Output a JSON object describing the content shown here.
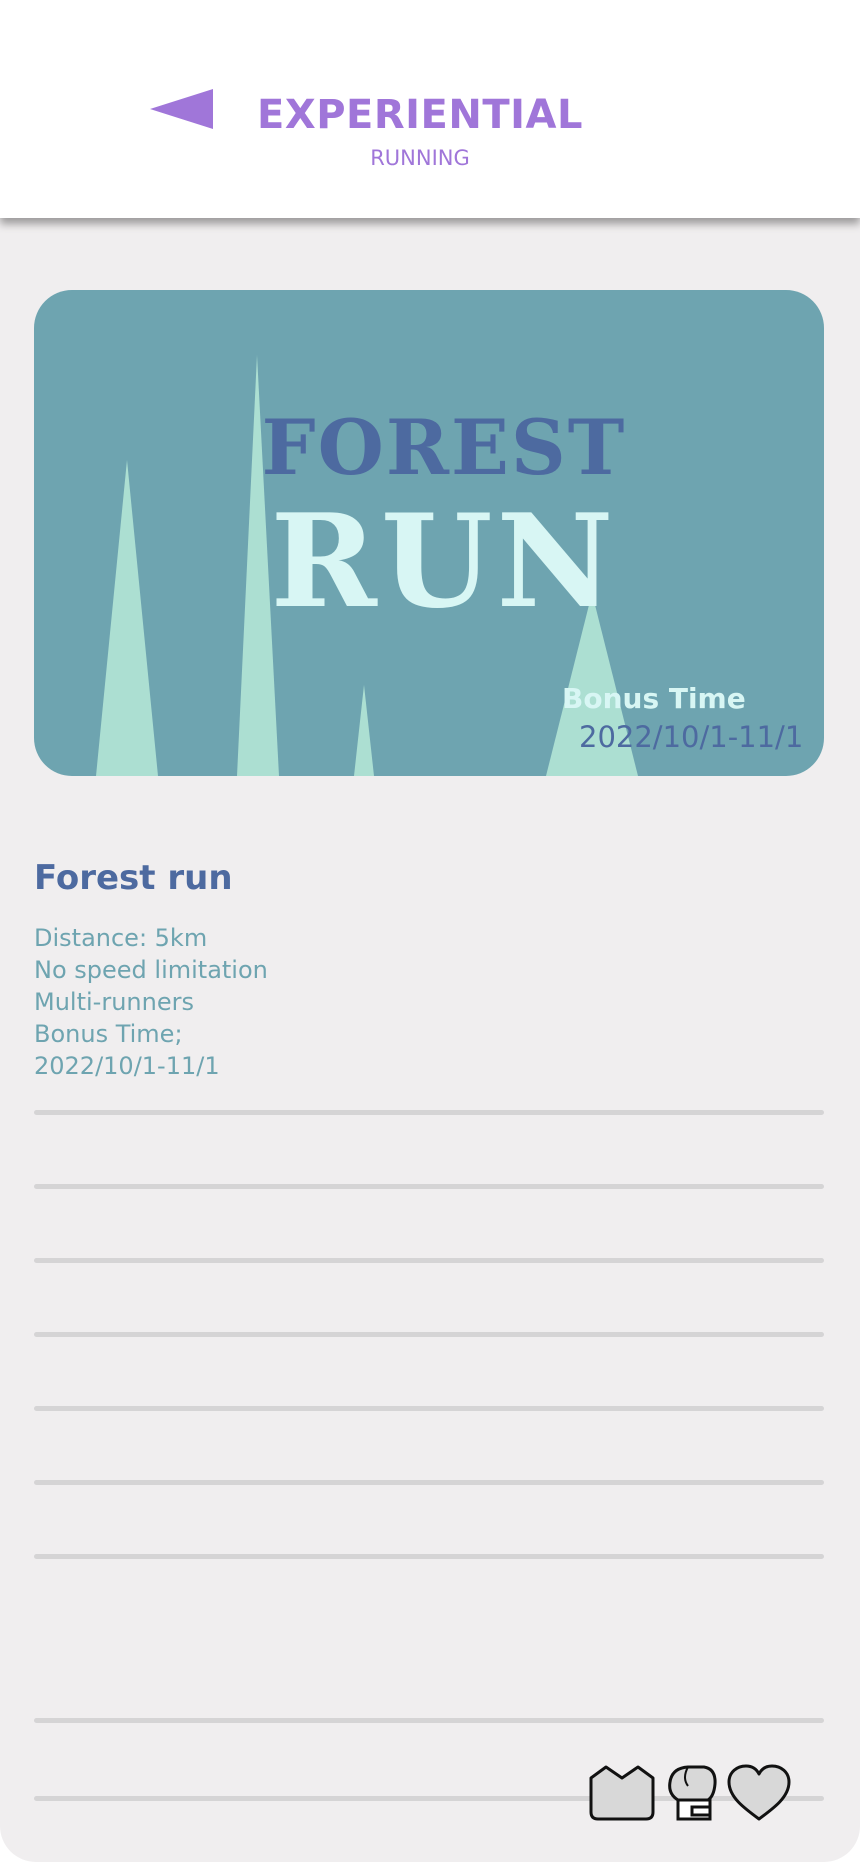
{
  "header": {
    "title": "EXPERIENTIAL",
    "subtitle": "RUNNING"
  },
  "banner": {
    "word1": "FOREST",
    "word2": "RUN",
    "bonus_label": "Bonus Time",
    "bonus_date": "2022/10/1-11/1"
  },
  "event": {
    "title": "Forest run",
    "details": [
      "Distance: 5km",
      "No speed limitation",
      "Multi-runners",
      "Bonus Time;",
      "2022/10/1-11/1"
    ]
  },
  "colors": {
    "accent": "#a076d9",
    "banner_bg": "#6ea4b0",
    "title_blue": "#4d6aa0",
    "tree": "#acdfd2",
    "pale_text": "#d8f6f4",
    "page_bg": "#f0eeef"
  },
  "icons": {
    "back": "back-arrow-icon",
    "crown": "crown-icon",
    "glove": "boxing-glove-icon",
    "heart": "heart-icon"
  }
}
